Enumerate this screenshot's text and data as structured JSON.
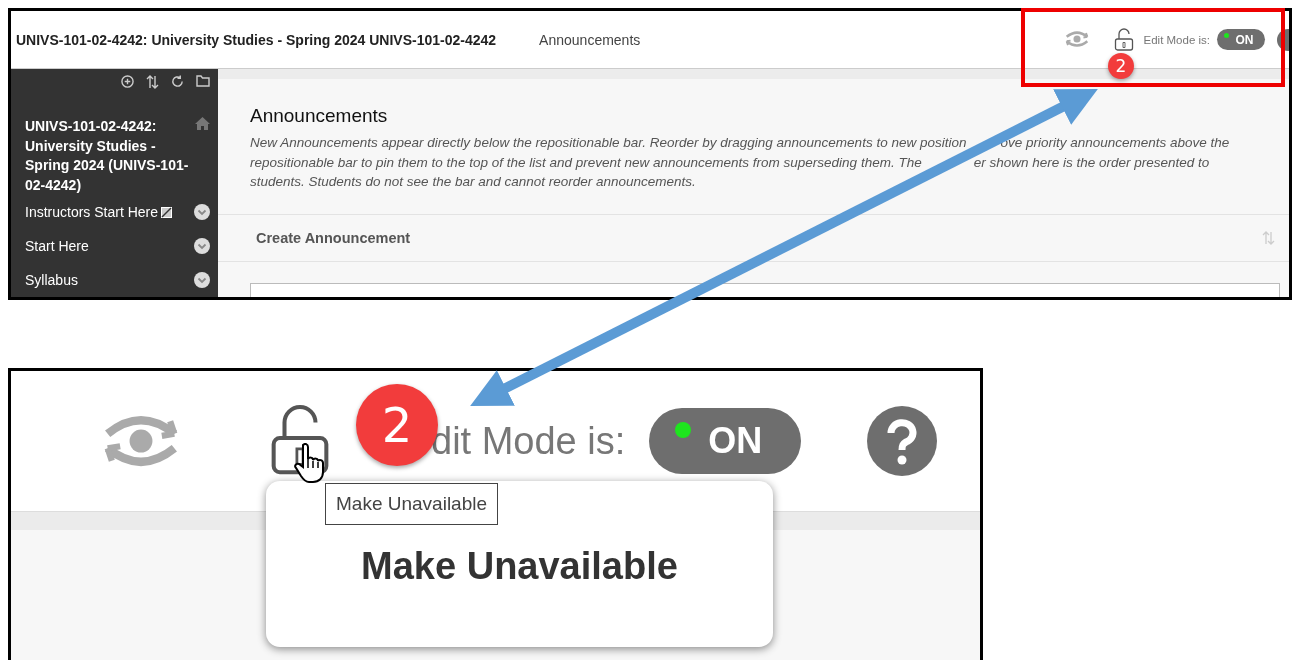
{
  "top_panel": {
    "header": {
      "course_title": "UNIVS-101-02-4242: University Studies - Spring 2024 UNIVS-101-02-4242",
      "breadcrumb": "Announcements",
      "edit_mode_label": "Edit Mode is:",
      "edit_mode_toggle": {
        "label": "ON",
        "on": true
      }
    },
    "sidebar": {
      "course_title": "UNIVS-101-02-4242: University Studies - Spring 2024 (UNIVS-101-02-4242)",
      "items": [
        {
          "label": "Instructors Start Here",
          "hidden_from_students": true
        },
        {
          "label": "Start Here",
          "hidden_from_students": false
        },
        {
          "label": "Syllabus",
          "hidden_from_students": false
        }
      ]
    },
    "main": {
      "title": "Announcements",
      "description_visible_parts": [
        "New Announcements appear directly below the repositionable bar. Reorder by dragging announcements to new position",
        "ove priority announcements above the repositionable bar to pin them to the top of the list and prevent new announcements from superseding them. The",
        "er shown here is the order presented to students. Students do not see the bar and cannot reorder announcements."
      ],
      "action": "Create Announcement"
    }
  },
  "zoomed_panel": {
    "edit_mode_label": "dit Mode is:",
    "edit_mode_toggle": {
      "label": "ON",
      "on": true
    },
    "tooltip": "Make Unavailable",
    "popup_title": "Make Unavailable"
  },
  "annotations": {
    "badges": [
      {
        "label": "2"
      },
      {
        "label": "2"
      }
    ]
  }
}
